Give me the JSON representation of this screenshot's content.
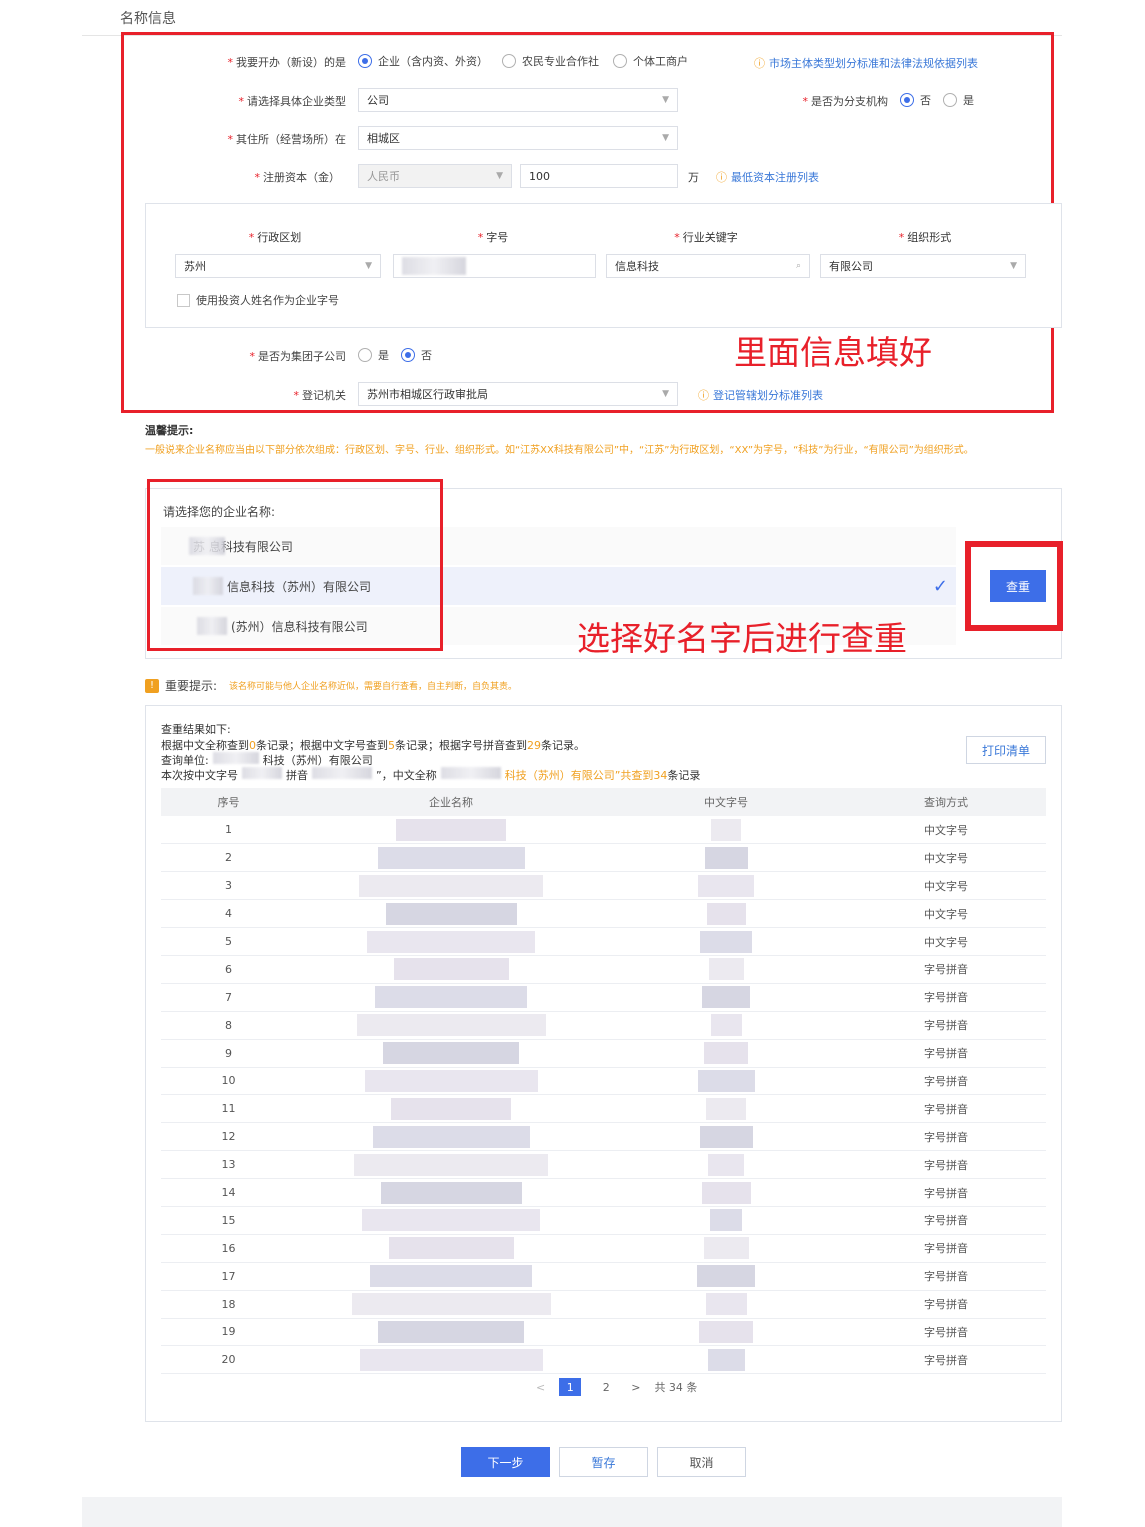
{
  "section_title": "名称信息",
  "form": {
    "open_type": {
      "label": "我要开办（新设）的是",
      "options": [
        "企业（含内资、外资）",
        "农民专业合作社",
        "个体工商户"
      ],
      "selected": 0,
      "link": "市场主体类型划分标准和法律法规依据列表"
    },
    "enterprise_type": {
      "label": "请选择具体企业类型",
      "value": "公司"
    },
    "is_branch": {
      "label": "是否为分支机构",
      "options": [
        "否",
        "是"
      ],
      "selected": 0
    },
    "residence": {
      "label": "其住所（经营场所）在",
      "value": "相城区"
    },
    "capital": {
      "label": "注册资本（金）",
      "currency": "人民币",
      "amount": "100",
      "unit": "万",
      "link": "最低资本注册列表"
    },
    "name_parts": {
      "headers": [
        "行政区划",
        "字号",
        "行业关键字",
        "组织形式"
      ],
      "region": "苏州",
      "trade_name": "",
      "industry": "信息科技",
      "org_form": "有限公司",
      "use_investor_name": "使用投资人姓名作为企业字号"
    },
    "is_group_sub": {
      "label": "是否为集团子公司",
      "options": [
        "是",
        "否"
      ],
      "selected": 1
    },
    "authority": {
      "label": "登记机关",
      "value": "苏州市相城区行政审批局",
      "link": "登记管辖划分标准列表"
    }
  },
  "annotations": {
    "fill_info": "里面信息填好",
    "check_dup": "选择好名字后进行查重"
  },
  "tips": {
    "title": "温馨提示:",
    "text": "一般说来企业名称应当由以下部分依次组成：行政区划、字号、行业、组织形式。如“江苏XX科技有限公司”中，“江苏”为行政区划，“XX”为字号，“科技”为行业，“有限公司”为组织形式。"
  },
  "name_select": {
    "title": "请选择您的企业名称:",
    "names": [
      "苏 息科技有限公司",
      "信息科技（苏州）有限公司",
      "(苏州）信息科技有限公司"
    ],
    "selected": 1,
    "check_button": "查重"
  },
  "important": {
    "title": "重要提示:",
    "text": "该名称可能与他人企业名称近似，需要自行查看，自主判断，自负其责。"
  },
  "results": {
    "heading": "查重结果如下:",
    "line1_a": "根据中文全称查到",
    "full_count": "0",
    "line1_b": "条记录；根据中文字号查到",
    "word_count": "5",
    "line1_c": "条记录；根据字号拼音查到",
    "pinyin_count": "29",
    "line1_d": "条记录。",
    "unit_label": "查询单位:",
    "unit_value": "科技（苏州）有限公司",
    "line3_a": "本次按中文字号",
    "line3_b": "拼音",
    "line3_c": "”，中文全称",
    "line3_d": "科技（苏州）有限公司”共查到",
    "total_count": "34",
    "line3_e": "条记录",
    "print_button": "打印清单",
    "columns": [
      "序号",
      "企业名称",
      "中文字号",
      "查询方式"
    ],
    "rows": [
      {
        "no": "1",
        "method": "中文字号"
      },
      {
        "no": "2",
        "method": "中文字号"
      },
      {
        "no": "3",
        "method": "中文字号"
      },
      {
        "no": "4",
        "method": "中文字号"
      },
      {
        "no": "5",
        "method": "中文字号"
      },
      {
        "no": "6",
        "method": "字号拼音"
      },
      {
        "no": "7",
        "method": "字号拼音"
      },
      {
        "no": "8",
        "method": "字号拼音"
      },
      {
        "no": "9",
        "method": "字号拼音"
      },
      {
        "no": "10",
        "method": "字号拼音"
      },
      {
        "no": "11",
        "method": "字号拼音"
      },
      {
        "no": "12",
        "method": "字号拼音"
      },
      {
        "no": "13",
        "method": "字号拼音"
      },
      {
        "no": "14",
        "method": "字号拼音"
      },
      {
        "no": "15",
        "method": "字号拼音"
      },
      {
        "no": "16",
        "method": "字号拼音"
      },
      {
        "no": "17",
        "method": "字号拼音"
      },
      {
        "no": "18",
        "method": "字号拼音"
      },
      {
        "no": "19",
        "method": "字号拼音"
      },
      {
        "no": "20",
        "method": "字号拼音"
      }
    ],
    "pager": {
      "prev": "<",
      "pages": [
        "1",
        "2"
      ],
      "current": "1",
      "next": ">",
      "total": "共 34 条"
    }
  },
  "footer_buttons": {
    "next": "下一步",
    "save": "暂存",
    "cancel": "取消"
  },
  "colors": {
    "accent": "#3d6ee8",
    "annotation": "#e8202a",
    "warning": "#f0a020"
  }
}
